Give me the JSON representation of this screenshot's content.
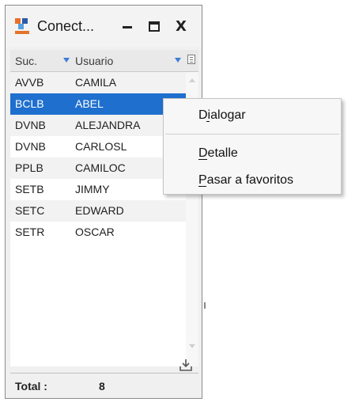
{
  "window": {
    "title": "Conect...",
    "buttons": {
      "minimize": "minimize",
      "maximize": "maximize",
      "close": "X"
    }
  },
  "table": {
    "columns": [
      {
        "label": "Suc."
      },
      {
        "label": "Usuario"
      }
    ],
    "rows": [
      {
        "suc": "AVVB",
        "usuario": "CAMILA"
      },
      {
        "suc": "BCLB",
        "usuario": "ABEL",
        "selected": true
      },
      {
        "suc": "DVNB",
        "usuario": "ALEJANDRA"
      },
      {
        "suc": "DVNB",
        "usuario": "CARLOSL"
      },
      {
        "suc": "PPLB",
        "usuario": "CAMILOC"
      },
      {
        "suc": "SETB",
        "usuario": "JIMMY"
      },
      {
        "suc": "SETC",
        "usuario": "EDWARD"
      },
      {
        "suc": "SETR",
        "usuario": "OSCAR"
      }
    ]
  },
  "footer": {
    "total_label": "Total :",
    "total_value": "8"
  },
  "context_menu": {
    "items": [
      {
        "label": "Dialogar",
        "accel_char": "i"
      },
      {
        "label": "Detalle",
        "accel_char": "D"
      },
      {
        "label": "Pasar a favoritos",
        "accel_char": "P"
      }
    ]
  },
  "colors": {
    "selection": "#1e6fce",
    "filter_arrow": "#3b7dd8",
    "logo_orange": "#e4722a",
    "logo_blue": "#2b5aa8"
  },
  "icons": [
    "app-logo-icon",
    "minimize-icon",
    "maximize-icon",
    "close-icon",
    "filter-icon",
    "column-menu-icon",
    "export-icon"
  ]
}
